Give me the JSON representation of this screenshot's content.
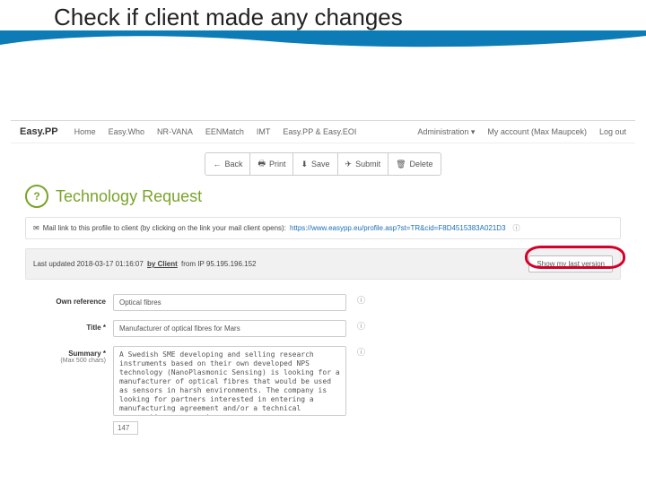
{
  "slide": {
    "title": "Check if client made any changes"
  },
  "nav": {
    "brand": "Easy.PP",
    "items": [
      "Home",
      "Easy.Who",
      "NR-VANA",
      "EENMatch",
      "IMT",
      "Easy.PP & Easy.EOI"
    ],
    "right": {
      "admin": "Administration ▾",
      "account": "My account (Max Maupcek)",
      "logout": "Log out"
    }
  },
  "toolbar": {
    "back": "Back",
    "print": "Print",
    "save": "Save",
    "submit": "Submit",
    "delete": "Delete",
    "icons": {
      "back": "←",
      "print": "🖶",
      "save": "⬇",
      "submit": "✈",
      "delete": "🗑"
    }
  },
  "page": {
    "badge": "?",
    "title": "Technology Request",
    "mail_label": "Mail link to this profile to client (by clicking on the link your mail client opens):",
    "mail_url": "https://www.easypp.eu/profile.asp?st=TR&cid=F8D4515383A021D3",
    "mail_icon": "✉",
    "info_icon": "ⓘ",
    "status_prefix": "Last updated 2018-03-17 01:16:07",
    "status_by": "by Client",
    "status_suffix": "from IP 95.195.196.152",
    "show_btn": "Show my last version"
  },
  "form": {
    "own_ref": {
      "label": "Own reference",
      "value": "Optical fibres"
    },
    "title": {
      "label": "Title *",
      "value": "Manufacturer of optical fibres for Mars"
    },
    "summary": {
      "label": "Summary *",
      "sub": "(Max 500 chars)",
      "value": "A Swedish SME developing and selling research instruments based on their own developed NPS technology (NanoPlasmonic Sensing) is looking for a manufacturer of optical fibres that would be used as sensors in harsh environments. The company is looking for partners interested in entering a manufacturing agreement and/or a technical cooperation agreement.",
      "count": "147"
    },
    "hint": "ⓘ"
  }
}
